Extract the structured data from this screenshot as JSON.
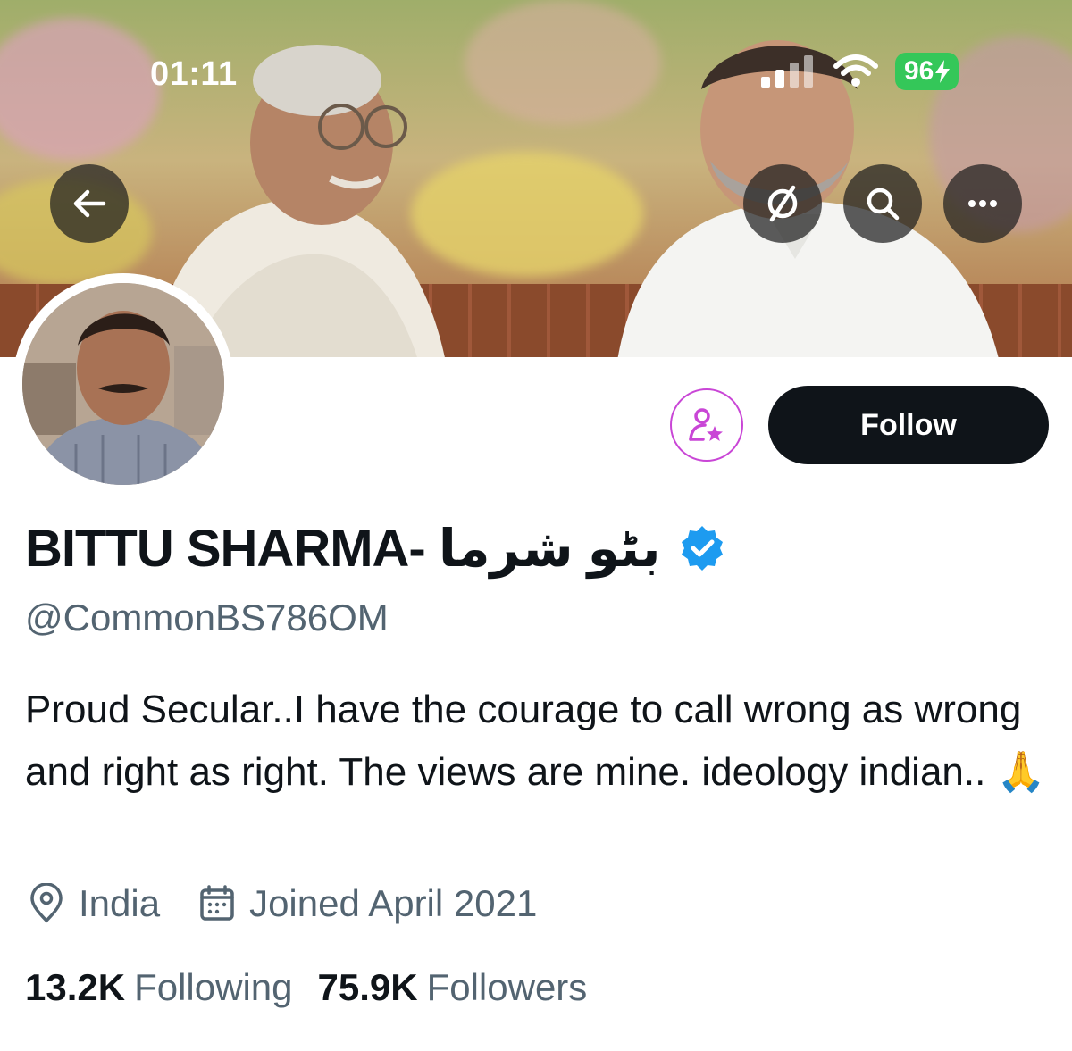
{
  "status_bar": {
    "time": "01:11",
    "battery": "96"
  },
  "header": {
    "back_icon": "arrow-left-icon",
    "grok_icon": "grok-icon",
    "search_icon": "search-icon",
    "more_icon": "more-icon"
  },
  "profile": {
    "display_name": "BITTU SHARMA- بٹو شرما",
    "verified": true,
    "handle": "@CommonBS786OM",
    "bio": "Proud Secular..I have the courage to call wrong as wrong and right as right. The views are mine. ideology indian.. 🙏",
    "location": "India",
    "joined": "Joined April 2021",
    "following_count": "13.2K",
    "following_label": "Following",
    "followers_count": "75.9K",
    "followers_label": "Followers"
  },
  "actions": {
    "follow_label": "Follow",
    "subscribe_icon": "subscribe-person-star-icon"
  },
  "colors": {
    "accent": "#1d9bf0",
    "subscribe": "#c946d6",
    "battery": "#34c759",
    "secondary_text": "#536471"
  }
}
